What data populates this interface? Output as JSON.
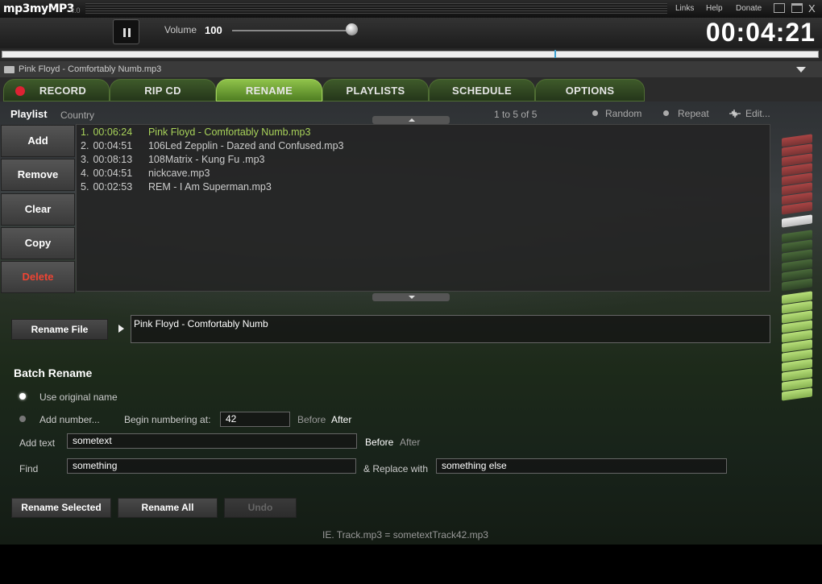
{
  "app": {
    "logo": "mp3myMP3",
    "version": "4.0"
  },
  "top_links": [
    "Links",
    "Help",
    "Donate"
  ],
  "window": {
    "close": "X"
  },
  "transport": {
    "volume_label": "Volume",
    "volume_value": "100",
    "volume_level": 1.0,
    "elapsed": "00:04:21"
  },
  "seek": {
    "position_fraction": 0.68
  },
  "now_playing": {
    "title": "Pink Floyd - Comfortably Numb.mp3"
  },
  "tabs": [
    {
      "label": "RECORD",
      "active": false
    },
    {
      "label": "RIP CD",
      "active": false
    },
    {
      "label": "RENAME",
      "active": true
    },
    {
      "label": "PLAYLISTS",
      "active": false
    },
    {
      "label": "SCHEDULE",
      "active": false
    },
    {
      "label": "OPTIONS",
      "active": false
    }
  ],
  "playlist": {
    "label": "Playlist",
    "name": "Country",
    "range": "1 to 5 of 5",
    "random_label": "Random",
    "repeat_label": "Repeat",
    "edit_label": "Edit...",
    "buttons": [
      "Add",
      "Remove",
      "Clear",
      "Copy",
      "Delete"
    ],
    "tracks": [
      {
        "num": "1.",
        "duration": "00:06:24",
        "name": "Pink Floyd - Comfortably Numb.mp3",
        "current": true
      },
      {
        "num": "2.",
        "duration": "00:04:51",
        "name": "106Led Zepplin - Dazed and Confused.mp3",
        "current": false
      },
      {
        "num": "3.",
        "duration": "00:08:13",
        "name": "108Matrix - Kung Fu .mp3",
        "current": false
      },
      {
        "num": "4.",
        "duration": "00:04:51",
        "name": "nickcave.mp3",
        "current": false
      },
      {
        "num": "5.",
        "duration": "00:02:53",
        "name": "REM - I Am Superman.mp3",
        "current": false
      }
    ]
  },
  "rename": {
    "button_label": "Rename   File",
    "filename": "Pink Floyd - Comfortably Numb"
  },
  "batch": {
    "title": "Batch Rename",
    "use_original_label": "Use original name",
    "add_number_label": "Add number...",
    "begin_label": "Begin numbering at:",
    "begin_value": "42",
    "number_before": "Before",
    "number_after": "After",
    "add_text_label": "Add text",
    "add_text_value": "sometext",
    "text_before": "Before",
    "text_after": "After",
    "find_label": "Find",
    "find_value": "something",
    "replace_label": "& Replace with",
    "replace_value": "something else",
    "rename_selected": "Rename Selected",
    "rename_all": "Rename All",
    "undo": "Undo",
    "example": "IE.   Track.mp3 = sometextTrack42.mp3"
  },
  "colors": {
    "accent_green": "#a8d25a",
    "tab_active": "#8fc24a",
    "record_red": "#dd2233",
    "delete_red": "#ee4433"
  }
}
